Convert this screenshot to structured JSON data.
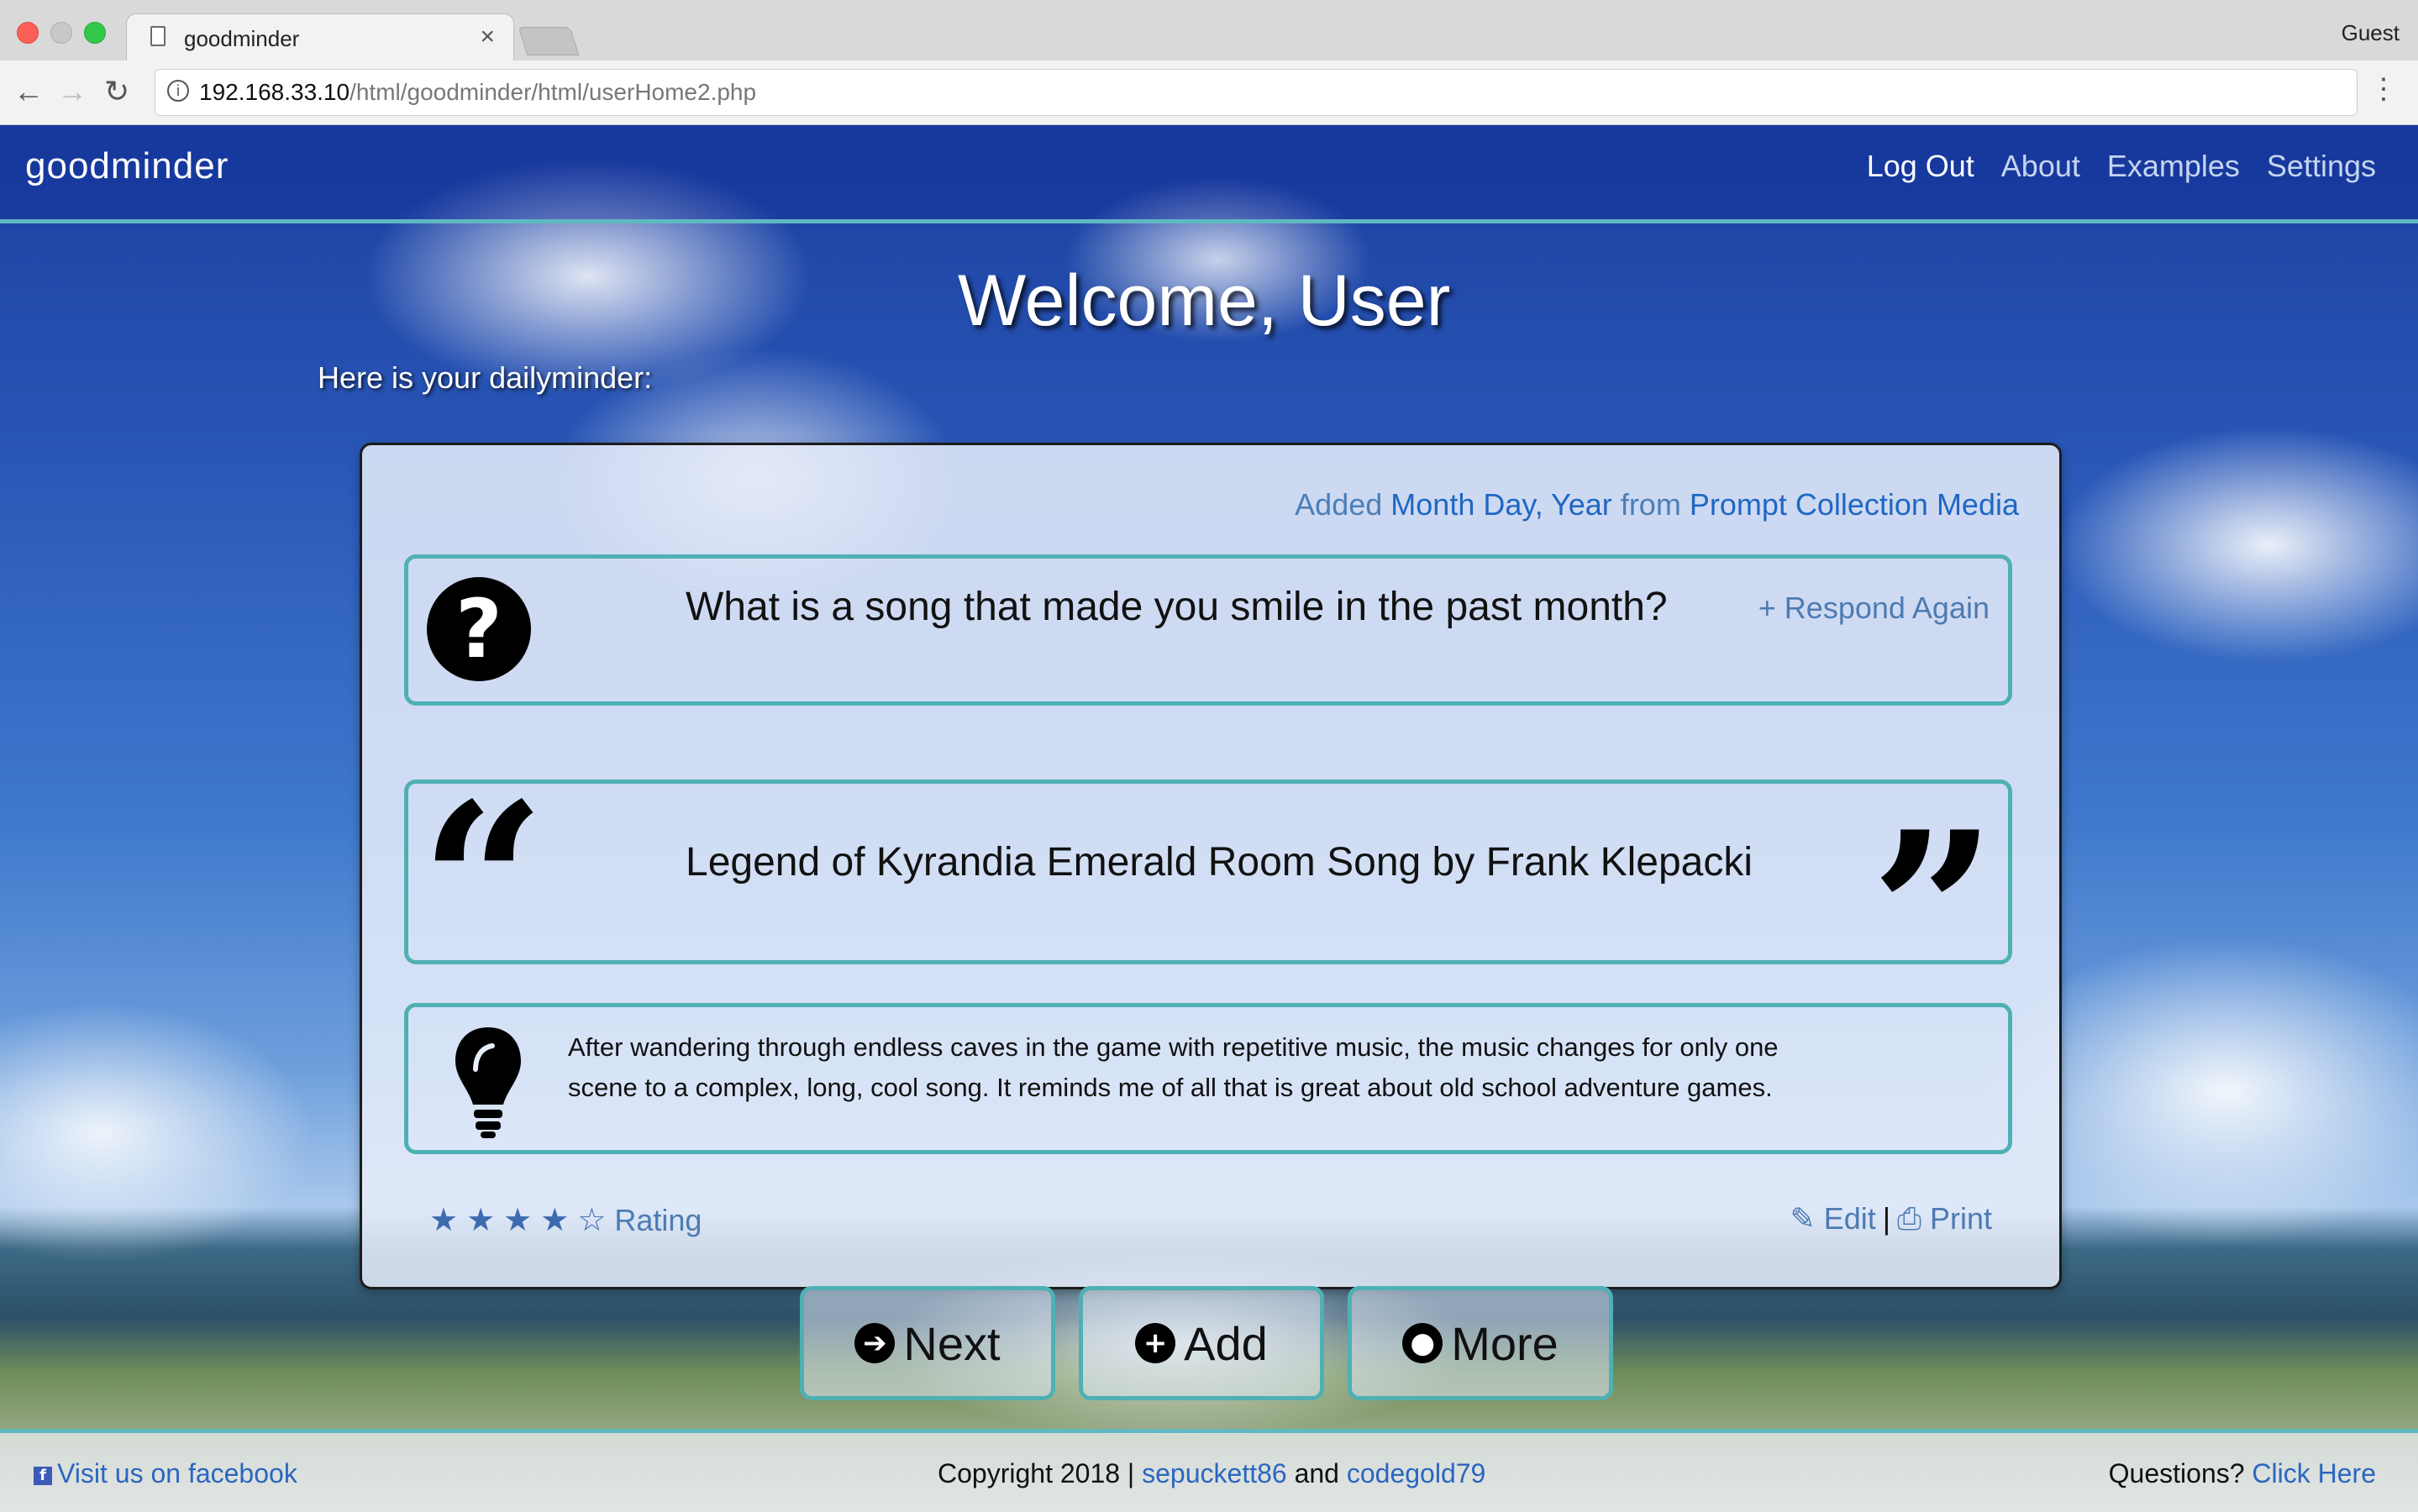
{
  "browser": {
    "tab_title": "goodminder",
    "tab_close": "×",
    "profile": "Guest",
    "url_host": "192.168.33.10",
    "url_path": "/html/goodminder/html/userHome2.php",
    "back": "←",
    "forward": "→",
    "reload": "↻",
    "menu": "⋮",
    "info": "i"
  },
  "navbar": {
    "brand": "goodminder",
    "links": [
      "Log Out",
      "About",
      "Examples",
      "Settings"
    ]
  },
  "main": {
    "welcome": "Welcome, User",
    "intro": "Here is your dailyminder:"
  },
  "card": {
    "added_prefix": "Added",
    "added_date": "Month Day, Year",
    "added_from": "from",
    "added_collection": "Prompt Collection Media",
    "question_glyph": "?",
    "question": "What is a song that made you smile in the past month?",
    "respond_again": "Respond Again",
    "respond_icon": "+",
    "quote_open": "“",
    "quote_close": "”",
    "answer": "Legend of Kyrandia Emerald Room Song by Frank Klepacki",
    "reason": "After wandering through endless caves in the game with repetitive music, the music changes for only one scene to a complex, long, cool song. It reminds me of all that is great about old school adventure games.",
    "rating": {
      "value": 4,
      "max": 5,
      "label": "Rating",
      "full_star": "★",
      "empty_star": "☆"
    },
    "edit": "Edit",
    "edit_icon": "✎",
    "print": "Print",
    "print_icon": "⎙",
    "separator": "|"
  },
  "actions": {
    "next": "Next",
    "next_icon": "➔",
    "add": "Add",
    "add_icon": "+",
    "more": "More",
    "more_icon": "●"
  },
  "footer": {
    "facebook_icon": "f",
    "facebook": "Visit us on facebook",
    "copyright": "Copyright 2018 |",
    "author1": "sepuckett86",
    "and": "and",
    "author2": "codegold79",
    "questions": "Questions?",
    "click_here": "Click Here"
  },
  "colors": {
    "accent": "#4fb0b4",
    "link": "#1f67c4",
    "navbar_text": "#ffffff"
  }
}
